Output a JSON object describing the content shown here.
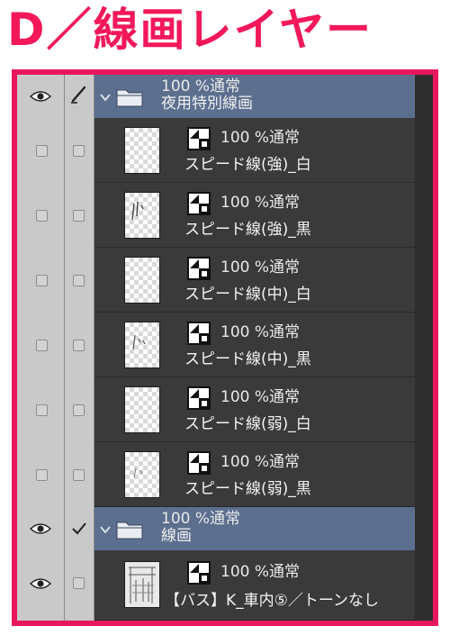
{
  "title": "D／線画レイヤー",
  "folders": [
    {
      "blend": "100 %通常",
      "name": "夜用特別線画"
    },
    {
      "blend": "100 %通常",
      "name": "線画"
    }
  ],
  "layers": [
    {
      "blend": "100 %通常",
      "name": "スピード線(強)_白"
    },
    {
      "blend": "100 %通常",
      "name": "スピード線(強)_黒"
    },
    {
      "blend": "100 %通常",
      "name": "スピード線(中)_白"
    },
    {
      "blend": "100 %通常",
      "name": "スピード線(中)_黒"
    },
    {
      "blend": "100 %通常",
      "name": "スピード線(弱)_白"
    },
    {
      "blend": "100 %通常",
      "name": "スピード線(弱)_黒"
    },
    {
      "blend": "100 %通常",
      "name": "【バス】K_車内⑤／トーンなし"
    }
  ],
  "colors": {
    "accent": "#e8175d",
    "folder_bg": "#5c6f8f",
    "panel_bg": "#3a3a3a"
  }
}
